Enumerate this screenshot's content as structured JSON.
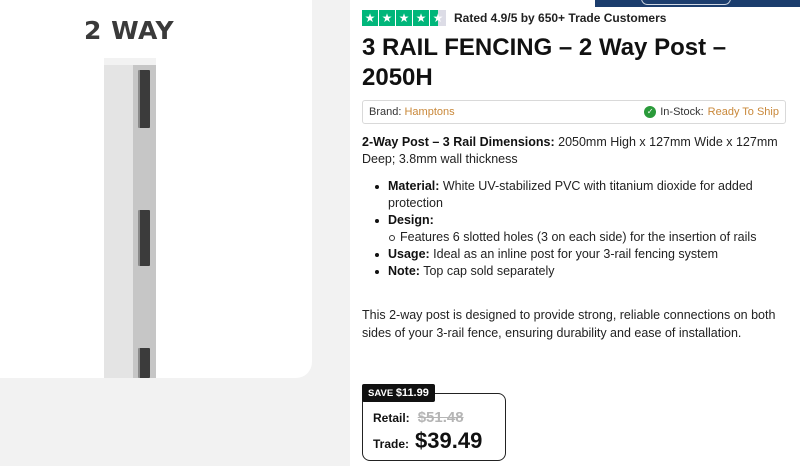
{
  "gallery": {
    "variant_label": "2 WAY",
    "image_alt": "3 rail fencing 2 way post"
  },
  "rating": {
    "stars": 4.5,
    "text": "Rated 4.9/5 by 650+ Trade Customers",
    "accent_color": "#00b67a"
  },
  "product": {
    "title": "3 RAIL FENCING – 2 Way Post – 2050H",
    "brand_label": "Brand:",
    "brand_value": "Hamptons",
    "stock_label": "In-Stock:",
    "stock_value": "Ready To Ship",
    "dims_label": "2-Way Post – 3 Rail Dimensions:",
    "dims_text": " 2050mm High x 127mm Wide x 127mm Deep; 3.8mm wall thickness",
    "features": {
      "material_label": "Material:",
      "material_text": " White UV-stabilized PVC with titanium dioxide for added protection",
      "design_label": "Design:",
      "design_sub": "Features 6 slotted holes (3 on each side) for the insertion of rails",
      "usage_label": "Usage:",
      "usage_text": " Ideal as an inline post for your 3-rail fencing system",
      "note_label": "Note:",
      "note_text": " Top cap sold separately"
    },
    "description": "This 2-way post is designed to provide strong, reliable connections on both sides of your 3-rail fence, ensuring durability and ease of installation."
  },
  "pricing": {
    "save_label": "SAVE",
    "save_amount": "$11.99",
    "retail_label": "Retail:",
    "retail_price": "$51.48",
    "trade_label": "Trade:",
    "trade_price": "$39.49"
  },
  "colors": {
    "brand_accent": "#c9883a",
    "header_bar": "#1b3d6d",
    "stock_check": "#2a9a3a"
  }
}
